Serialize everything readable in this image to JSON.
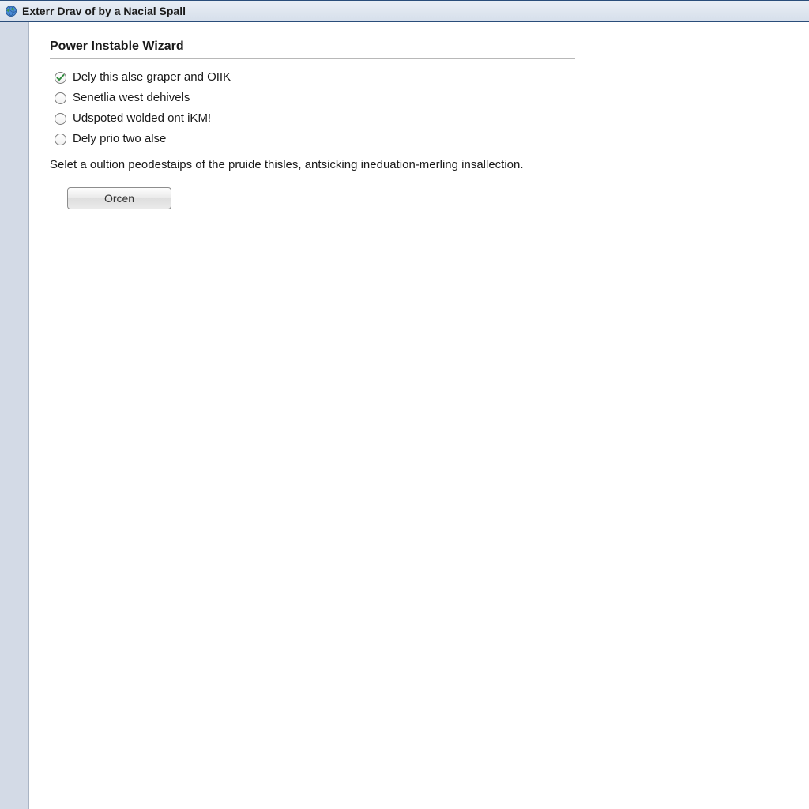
{
  "window": {
    "title": "Exterr Drav of by a Nacial Spall",
    "icon": "globe-icon"
  },
  "wizard": {
    "heading": "Power Instable Wizard",
    "options": [
      {
        "label": "Dely this alse graper and OIIK",
        "selected": true
      },
      {
        "label": "Senetlia west dehivels",
        "selected": false
      },
      {
        "label": "Udspoted wolded ont iKM!",
        "selected": false
      },
      {
        "label": "Dely prio two alse",
        "selected": false
      }
    ],
    "description": "Selet a oultion peodestaips of the pruide thisles, antsicking ineduation-merling insallection.",
    "button_label": "Orcen"
  }
}
